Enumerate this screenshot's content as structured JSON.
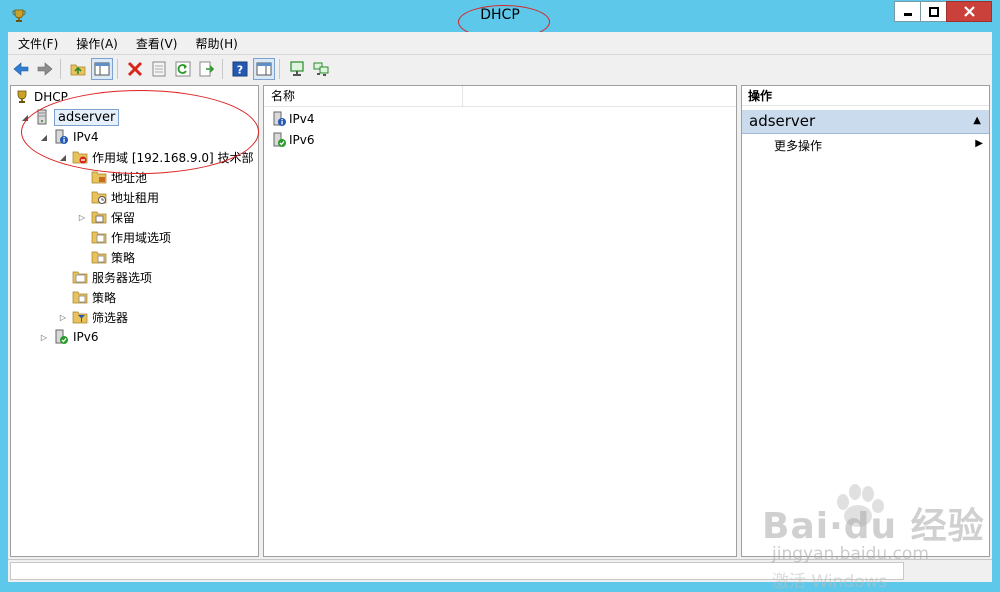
{
  "window": {
    "title": "DHCP",
    "min_glyph": "▁",
    "max_glyph": "□",
    "close_glyph": "✕"
  },
  "menu": [
    "文件(F)",
    "操作(A)",
    "查看(V)",
    "帮助(H)"
  ],
  "toolbar": {
    "icons": [
      "back-arrow-icon",
      "forward-arrow-icon",
      "up-folder-icon",
      "show-hide-tree-icon",
      "delete-icon",
      "properties-icon",
      "refresh-icon",
      "export-list-icon",
      "help-icon",
      "show-action-pane-icon",
      "server-display-icon",
      "server-network-icon"
    ]
  },
  "tree": {
    "root": "DHCP",
    "server": "adserver",
    "ipv4": "IPv4",
    "scope": "作用域 [192.168.9.0] 技术部",
    "scope_children": [
      "地址池",
      "地址租用",
      "保留",
      "作用域选项",
      "策略"
    ],
    "ipv4_children": [
      "服务器选项",
      "策略",
      "筛选器"
    ],
    "ipv6": "IPv6"
  },
  "list": {
    "column_name": "名称",
    "rows": [
      "IPv4",
      "IPv6"
    ]
  },
  "actions": {
    "header": "操作",
    "section": "adserver",
    "item": "更多操作"
  },
  "watermark": {
    "brand": "Bai·du 经验",
    "url": "jingyan.baidu.com",
    "activate": "激活 Windows"
  },
  "colors": {
    "titlebar": "#5ec8ea",
    "close_button": "#c9413a",
    "selection": "#e5f0fb",
    "action_section": "#cadbee",
    "annotation": "#dd2222"
  }
}
